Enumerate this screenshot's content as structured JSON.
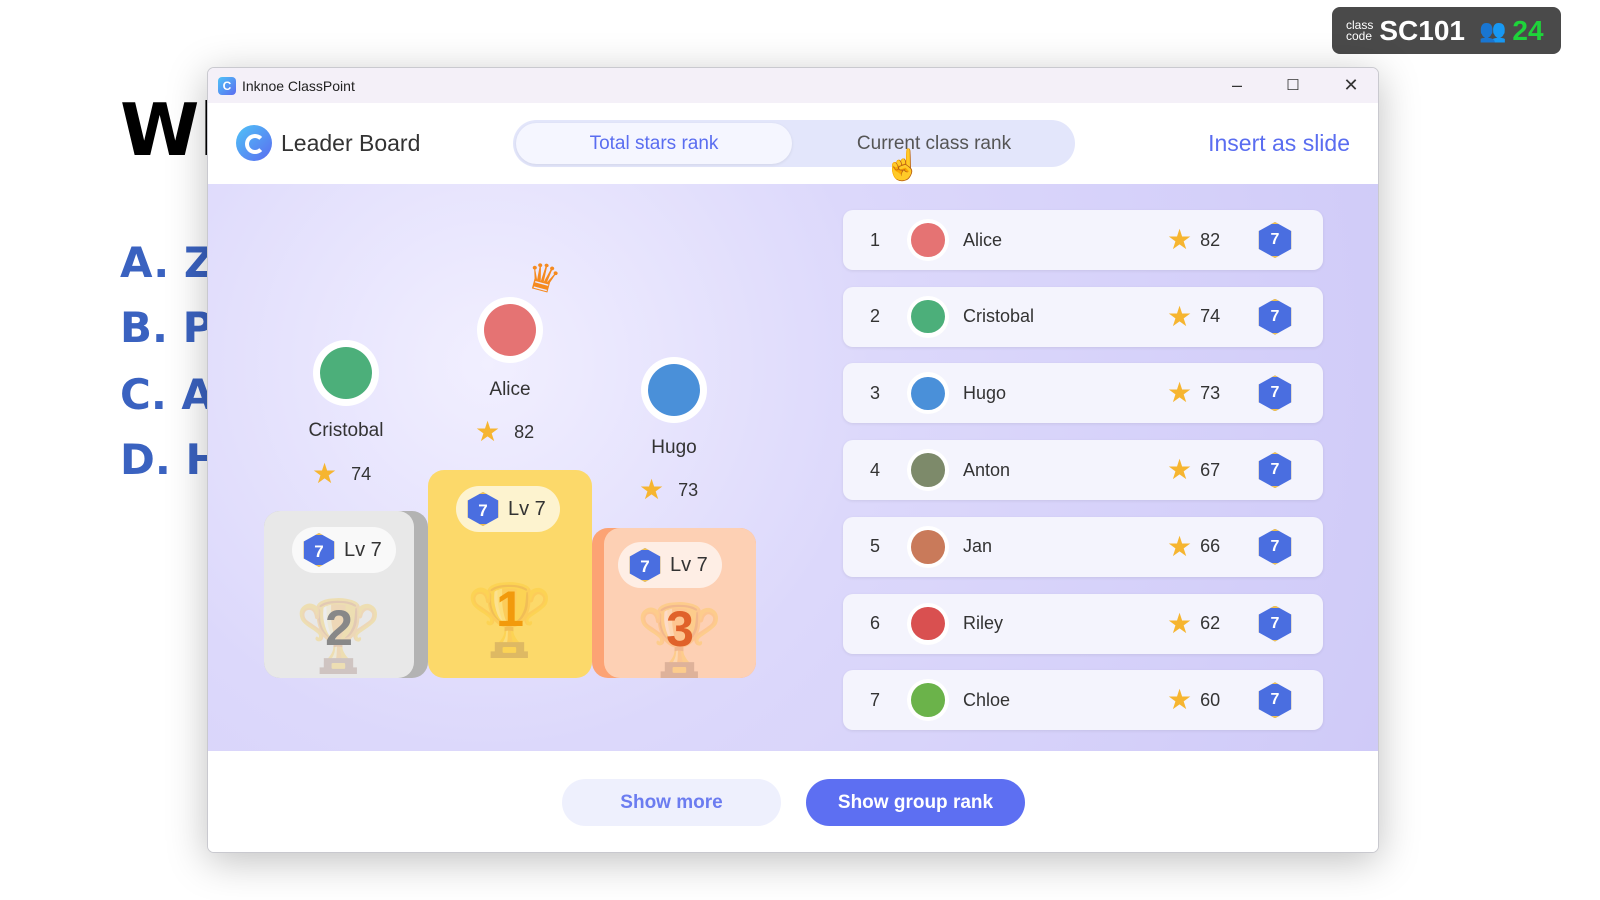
{
  "slide": {
    "title": "Wh",
    "options": [
      "A. Z",
      "B. P",
      "C. A",
      "D. H"
    ]
  },
  "class_badge": {
    "label_line1": "class",
    "label_line2": "code",
    "code": "SC101",
    "participants": "24",
    "icon": "people-icon"
  },
  "window": {
    "title": "Inknoe ClassPoint",
    "controls": {
      "minimize": "–",
      "maximize": "☐",
      "close": "✕"
    }
  },
  "header": {
    "title": "Leader Board",
    "tabs": [
      {
        "label": "Total stars rank",
        "active": true
      },
      {
        "label": "Current class rank",
        "active": false
      }
    ],
    "insert_label": "Insert as slide"
  },
  "podium": [
    {
      "place": "2",
      "name": "Cristobal",
      "stars": "74",
      "level": "Lv 7",
      "badge": "7"
    },
    {
      "place": "1",
      "name": "Alice",
      "stars": "82",
      "level": "Lv 7",
      "badge": "7"
    },
    {
      "place": "3",
      "name": "Hugo",
      "stars": "73",
      "level": "Lv 7",
      "badge": "7"
    }
  ],
  "ranking": [
    {
      "rank": "1",
      "name": "Alice",
      "stars": "82",
      "badge": "7",
      "color": "#e57373"
    },
    {
      "rank": "2",
      "name": "Cristobal",
      "stars": "74",
      "badge": "7",
      "color": "#4caf7a"
    },
    {
      "rank": "3",
      "name": "Hugo",
      "stars": "73",
      "badge": "7",
      "color": "#4a90d9"
    },
    {
      "rank": "4",
      "name": "Anton",
      "stars": "67",
      "badge": "7",
      "color": "#7d8a6a"
    },
    {
      "rank": "5",
      "name": "Jan",
      "stars": "66",
      "badge": "7",
      "color": "#c97a5a"
    },
    {
      "rank": "6",
      "name": "Riley",
      "stars": "62",
      "badge": "7",
      "color": "#d95050"
    },
    {
      "rank": "7",
      "name": "Chloe",
      "stars": "60",
      "badge": "7",
      "color": "#6bb34a"
    }
  ],
  "footer": {
    "show_more": "Show more",
    "show_group_rank": "Show group rank"
  },
  "colors": {
    "accent": "#5a6df0",
    "gold": "#fcd96a",
    "silver": "#e8e8e8",
    "bronze": "#fdd0b4"
  }
}
